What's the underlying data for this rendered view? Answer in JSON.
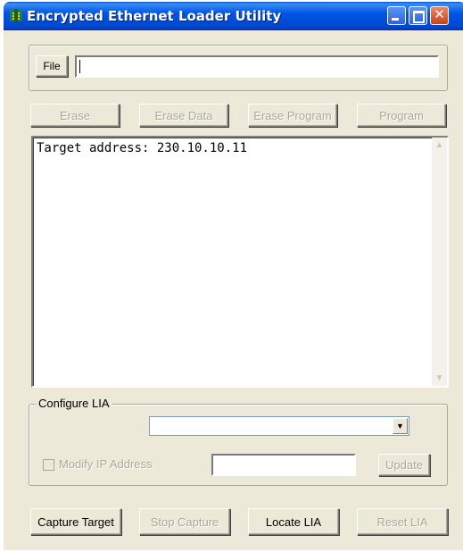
{
  "window": {
    "title": "Encrypted Ethernet Loader Utility",
    "title_icon": "app-icon",
    "minimize_icon": "minimize-icon",
    "maximize_icon": "maximize-icon",
    "close_icon": "close-icon"
  },
  "file": {
    "button_label": "File",
    "path_value": ""
  },
  "actions": {
    "erase": "Erase",
    "erase_data": "Erase Data",
    "erase_program": "Erase Program",
    "program": "Program"
  },
  "console": {
    "text": "Target address: 230.10.10.11"
  },
  "configure": {
    "group_label": "Configure LIA",
    "select_value": "",
    "modify_ip_label": "Modify IP Address",
    "modify_ip_checked": false,
    "ip_value": "",
    "update_label": "Update"
  },
  "bottom": {
    "capture_target": "Capture Target",
    "stop_capture": "Stop Capture",
    "locate_lia": "Locate LIA",
    "reset_lia": "Reset LIA"
  },
  "colors": {
    "titlebar": "#0055e5",
    "window_bg": "#ece9d8",
    "disabled_text": "#aca899"
  }
}
